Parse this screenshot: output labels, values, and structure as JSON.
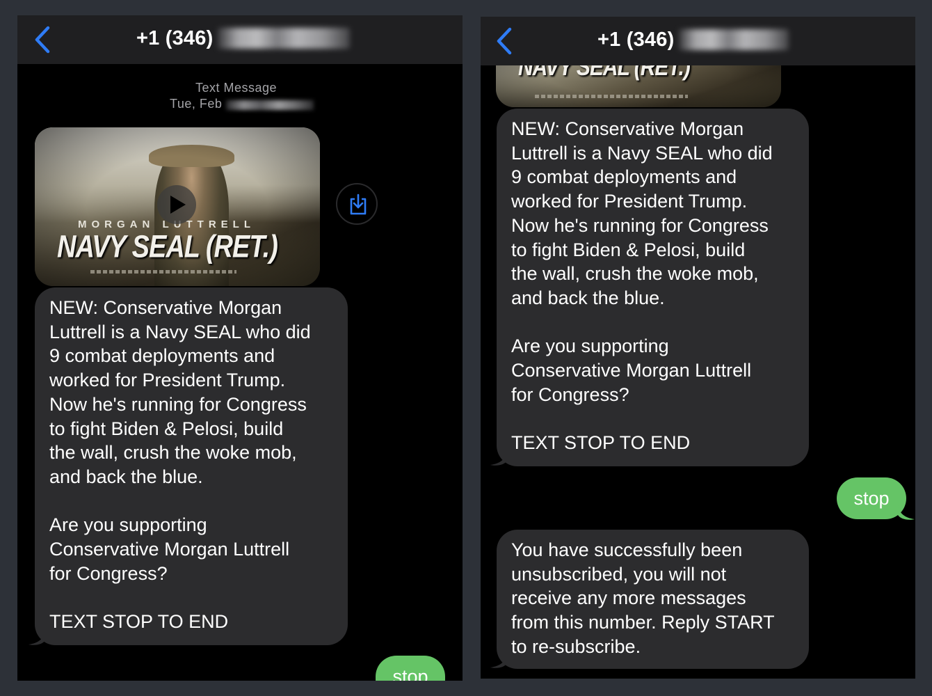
{
  "left_panel": {
    "contact": "+1 (346)",
    "meta_label": "Text Message",
    "meta_date": "Tue, Feb",
    "media": {
      "caption_name": "MORGAN LUTTRELL",
      "caption_title": "NAVY SEAL (RET.)"
    },
    "message": "NEW: Conservative Morgan\nLuttrell is a Navy SEAL who did\n9 combat deployments and\nworked for President Trump.\nNow he's running for Congress\nto fight Biden & Pelosi, build\nthe wall, crush the woke mob,\nand back the blue.\n\nAre you supporting\nConservative Morgan Luttrell\nfor Congress?\n\nTEXT STOP TO END",
    "reply": "stop"
  },
  "right_panel": {
    "contact": "+1 (346)",
    "media": {
      "caption_title": "NAVY SEAL (RET.)"
    },
    "message": "NEW: Conservative Morgan\nLuttrell is a Navy SEAL who did\n9 combat deployments and\nworked for President Trump.\nNow he's running for Congress\nto fight Biden & Pelosi, build\nthe wall, crush the woke mob,\nand back the blue.\n\nAre you supporting\nConservative Morgan Luttrell\nfor Congress?\n\nTEXT STOP TO END",
    "reply": "stop",
    "confirmation": "You have successfully been\nunsubscribed, you will not\nreceive any more messages\nfrom this number. Reply START\nto re-subscribe."
  },
  "icons": {
    "back": "chevron-left-icon",
    "play": "play-icon",
    "save": "save-to-device-icon"
  },
  "colors": {
    "accent_blue": "#2f7cf6",
    "sent_bubble": "#65c466",
    "received_bubble": "#2c2c2e"
  }
}
